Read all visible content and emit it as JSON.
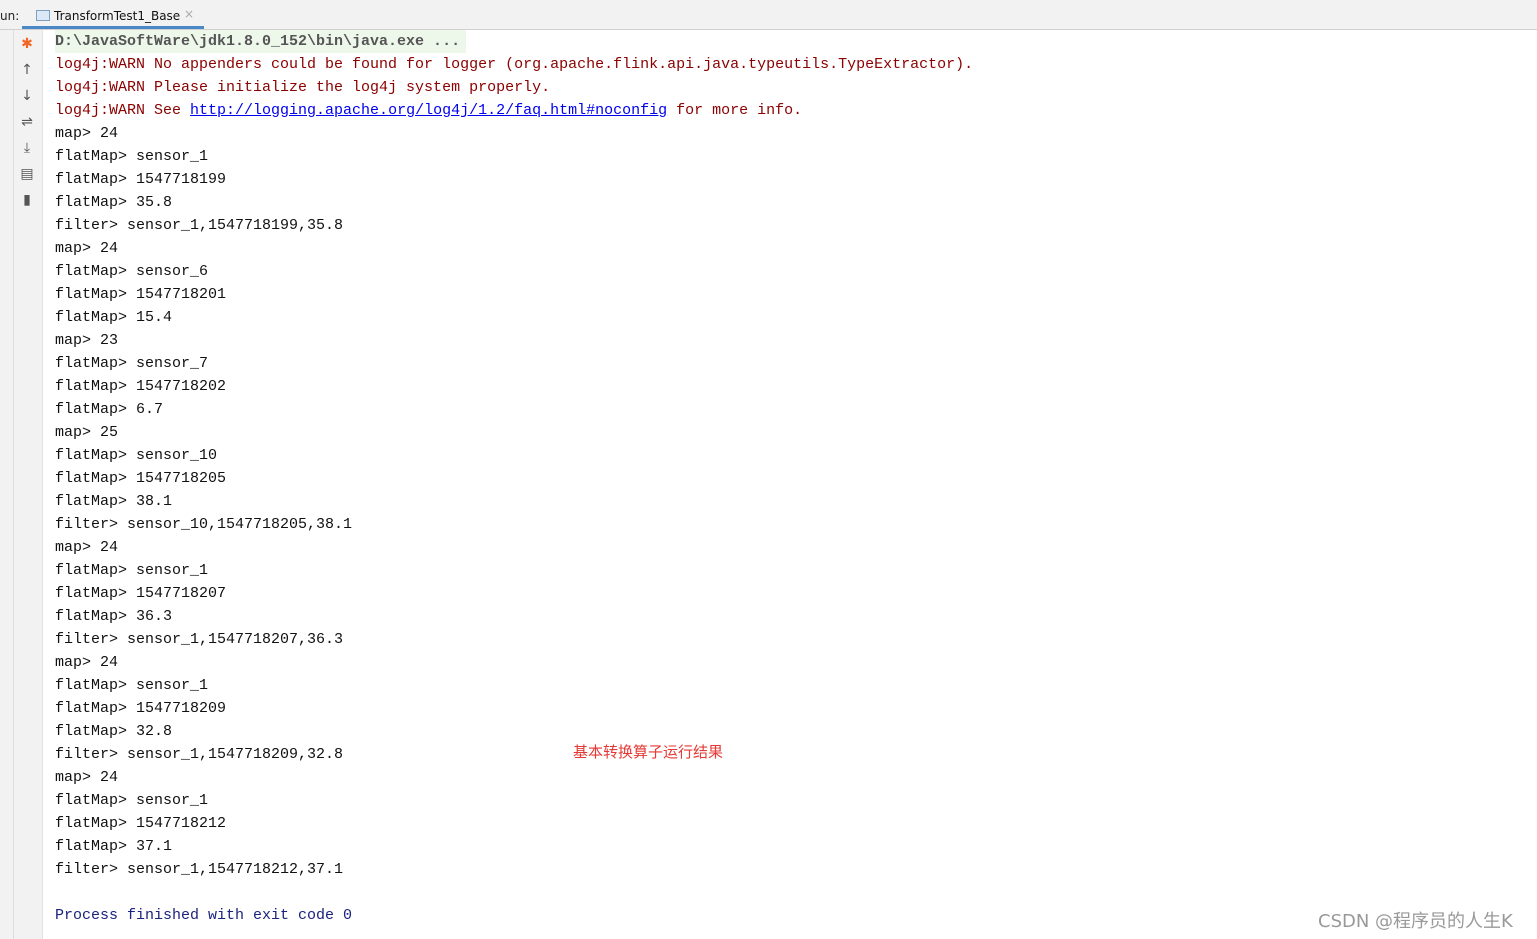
{
  "run_label": "un:",
  "tab": {
    "label": "TransformTest1_Base",
    "close": "×"
  },
  "toolbar": [
    "debug-icon",
    "arrow-up-icon",
    "arrow-down-icon",
    "soft-wrap-icon",
    "scroll-to-end-icon",
    "print-icon",
    "trash-icon"
  ],
  "console": {
    "command": "D:\\JavaSoftWare\\jdk1.8.0_152\\bin\\java.exe ...",
    "warn1": "log4j:WARN No appenders could be found for logger (org.apache.flink.api.java.typeutils.TypeExtractor).",
    "warn2": "log4j:WARN Please initialize the log4j system properly.",
    "warn3_prefix": "log4j:WARN See ",
    "warn3_link": "http://logging.apache.org/log4j/1.2/faq.html#noconfig",
    "warn3_suffix": " for more info.",
    "output": [
      "map> 24",
      "flatMap> sensor_1",
      "flatMap> 1547718199",
      "flatMap> 35.8",
      "filter> sensor_1,1547718199,35.8",
      "map> 24",
      "flatMap> sensor_6",
      "flatMap> 1547718201",
      "flatMap> 15.4",
      "map> 23",
      "flatMap> sensor_7",
      "flatMap> 1547718202",
      "flatMap> 6.7",
      "map> 25",
      "flatMap> sensor_10",
      "flatMap> 1547718205",
      "flatMap> 38.1",
      "filter> sensor_10,1547718205,38.1",
      "map> 24",
      "flatMap> sensor_1",
      "flatMap> 1547718207",
      "flatMap> 36.3",
      "filter> sensor_1,1547718207,36.3",
      "map> 24",
      "flatMap> sensor_1",
      "flatMap> 1547718209",
      "flatMap> 32.8",
      "filter> sensor_1,1547718209,32.8",
      "map> 24",
      "flatMap> sensor_1",
      "flatMap> 1547718212",
      "flatMap> 37.1",
      "filter> sensor_1,1547718212,37.1"
    ],
    "finished": "Process finished with exit code 0"
  },
  "annotation": "基本转换算子运行结果",
  "watermark": "CSDN @程序员的人生K"
}
